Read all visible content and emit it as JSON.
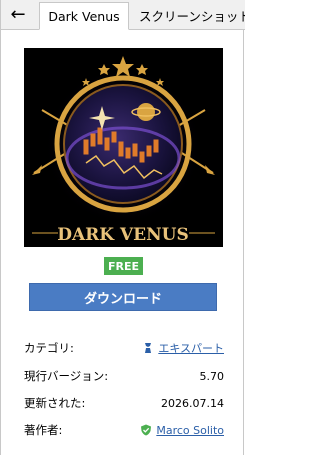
{
  "tabs": {
    "back": "←",
    "active": "Dark Venus",
    "inactive": "スクリーンショット"
  },
  "product": {
    "logo_text": "DARK VENUS",
    "badge": "FREE",
    "download_label": "ダウンロード"
  },
  "info": [
    {
      "label": "カテゴリ:",
      "value": "エキスパート",
      "icon": "expert-icon"
    },
    {
      "label": "現行バージョン:",
      "value": "5.70"
    },
    {
      "label": "更新された:",
      "value": "2026.07.14"
    },
    {
      "label": "著作者:",
      "value": "Marco Solito",
      "icon": "verified-shield-icon"
    }
  ],
  "colors": {
    "badge": "#4caf50",
    "button": "#4a7cc4",
    "link": "#2b5fa8",
    "gold": "#d9a441"
  }
}
